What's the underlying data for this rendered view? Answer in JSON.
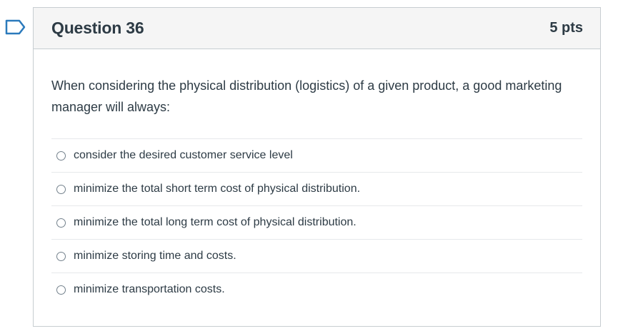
{
  "question": {
    "title": "Question 36",
    "points": "5 pts",
    "text": "When considering the physical distribution (logistics) of a given product, a good marketing manager will always:",
    "answers": [
      {
        "label": "consider the desired customer service level"
      },
      {
        "label": "minimize the total short term cost of physical distribution."
      },
      {
        "label": "minimize the total long term cost of physical distribution."
      },
      {
        "label": "minimize storing time and costs."
      },
      {
        "label": "minimize transportation costs."
      }
    ]
  },
  "icons": {
    "flag": "flag-icon",
    "radio": "radio-icon"
  },
  "colors": {
    "flag_outline": "#2b7abc",
    "header_background": "#f5f5f5",
    "border": "#c7cdd1",
    "text": "#2d3b45"
  }
}
